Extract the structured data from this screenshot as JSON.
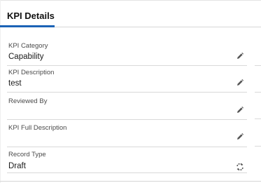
{
  "tabs": [
    {
      "label": "KPI Details",
      "active": true
    }
  ],
  "fields": [
    {
      "label": "KPI Category",
      "value": "Capability",
      "icon": "pencil-icon"
    },
    {
      "label": "KPI Description",
      "value": "test",
      "icon": "pencil-icon"
    },
    {
      "label": "Reviewed By",
      "value": "",
      "icon": "pencil-icon"
    },
    {
      "label": "KPI Full Description",
      "value": "",
      "icon": "pencil-icon"
    },
    {
      "label": "Record Type",
      "value": "Draft",
      "icon": "change-record-type-icon"
    }
  ],
  "colors": {
    "accent": "#1b63b6",
    "divider": "#d9d9d9",
    "icon": "#555555"
  }
}
